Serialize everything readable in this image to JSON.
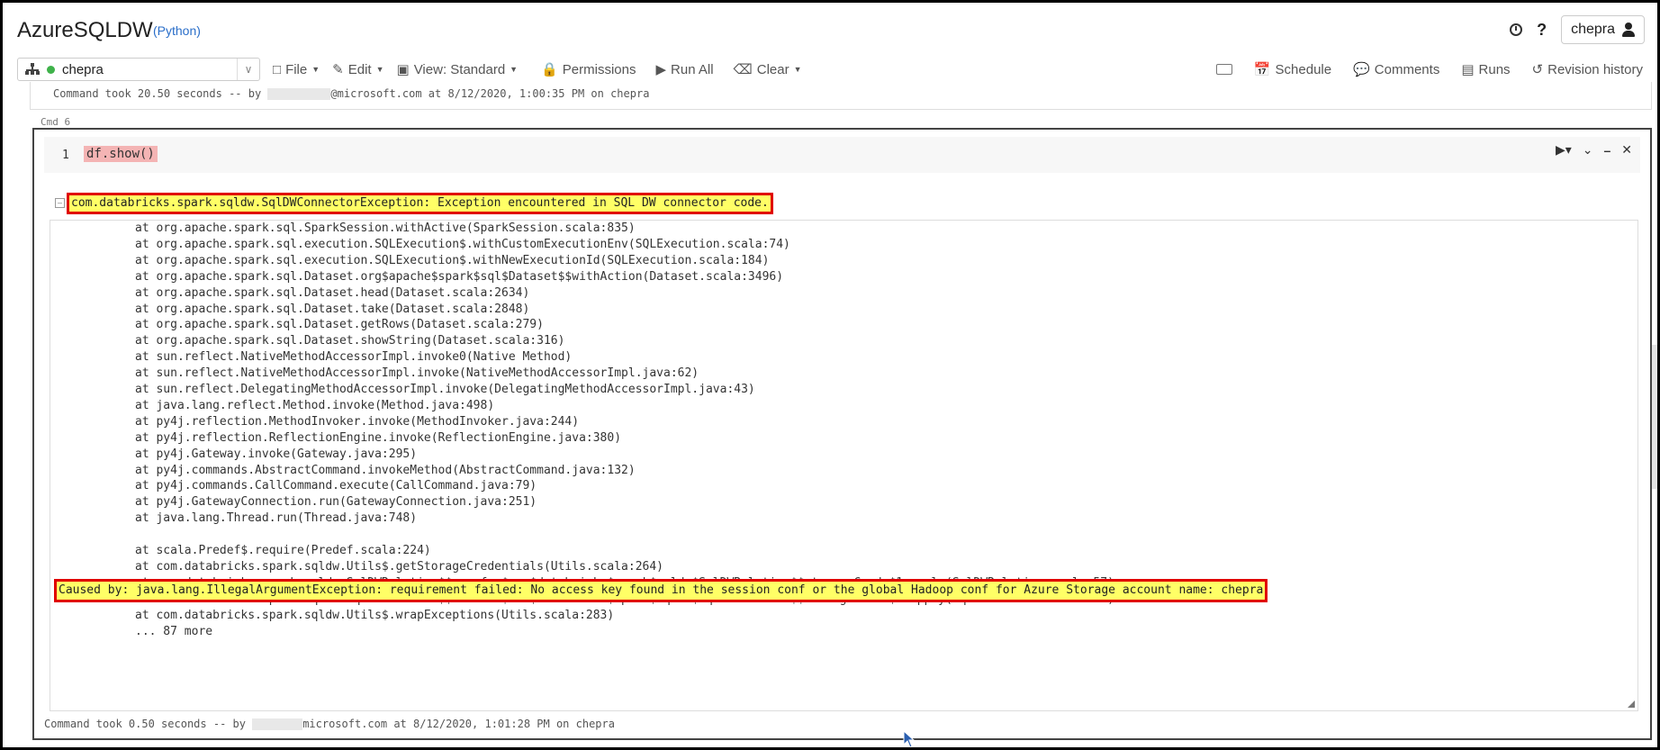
{
  "header": {
    "title": "AzureSQLDW",
    "language": "(Python)",
    "user": "chepra"
  },
  "toolbar": {
    "cluster": "chepra",
    "file": "File",
    "edit": "Edit",
    "view": "View: Standard",
    "permissions": "Permissions",
    "run_all": "Run All",
    "clear": "Clear",
    "schedule": "Schedule",
    "comments": "Comments",
    "runs": "Runs",
    "revision_history": "Revision history"
  },
  "prev_cell": {
    "took_prefix": "Command took 20.50 seconds -- by ",
    "took_suffix": "@microsoft.com at 8/12/2020, 1:00:35 PM on chepra"
  },
  "cell": {
    "label": "Cmd 6",
    "line_number": "1",
    "code": "df.show()",
    "exception": "com.databricks.spark.sqldw.SqlDWConnectorException: Exception encountered in SQL DW connector code.",
    "trace": [
      "at org.apache.spark.sql.SparkSession.withActive(SparkSession.scala:835)",
      "at org.apache.spark.sql.execution.SQLExecution$.withCustomExecutionEnv(SQLExecution.scala:74)",
      "at org.apache.spark.sql.execution.SQLExecution$.withNewExecutionId(SQLExecution.scala:184)",
      "at org.apache.spark.sql.Dataset.org$apache$spark$sql$Dataset$$withAction(Dataset.scala:3496)",
      "at org.apache.spark.sql.Dataset.head(Dataset.scala:2634)",
      "at org.apache.spark.sql.Dataset.take(Dataset.scala:2848)",
      "at org.apache.spark.sql.Dataset.getRows(Dataset.scala:279)",
      "at org.apache.spark.sql.Dataset.showString(Dataset.scala:316)",
      "at sun.reflect.NativeMethodAccessorImpl.invoke0(Native Method)",
      "at sun.reflect.NativeMethodAccessorImpl.invoke(NativeMethodAccessorImpl.java:62)",
      "at sun.reflect.DelegatingMethodAccessorImpl.invoke(DelegatingMethodAccessorImpl.java:43)",
      "at java.lang.reflect.Method.invoke(Method.java:498)",
      "at py4j.reflection.MethodInvoker.invoke(MethodInvoker.java:244)",
      "at py4j.reflection.ReflectionEngine.invoke(ReflectionEngine.java:380)",
      "at py4j.Gateway.invoke(Gateway.java:295)",
      "at py4j.commands.AbstractCommand.invokeMethod(AbstractCommand.java:132)",
      "at py4j.commands.CallCommand.execute(CallCommand.java:79)",
      "at py4j.GatewayConnection.run(GatewayConnection.java:251)",
      "at java.lang.Thread.run(Thread.java:748)"
    ],
    "caused_by": "Caused by: java.lang.IllegalArgumentException: requirement failed: No access key found in the session conf or the global Hadoop conf for Azure Storage account name: chepra",
    "trace2": [
      "at scala.Predef$.require(Predef.scala:224)",
      "at com.databricks.spark.sqldw.Utils$.getStorageCredentials(Utils.scala:264)",
      "at com.databricks.spark.sqldw.SqlDWRelation$$anonfun$com$databricks$spark$sqldw$SqlDWRelation$$storageCreds$1.apply(SqlDWRelation.scala:57)",
      "at com.databricks.spark.sqldw.SqlDWRelation$$anonfun$com$databricks$spark$sqldw$SqlDWRelation$$storageCreds$1.apply(SqlDWRelation.scala:54)",
      "at com.databricks.spark.sqldw.Utils$.wrapExceptions(Utils.scala:283)",
      "... 87 more"
    ],
    "took_prefix": "Command took 0.50 seconds -- by ",
    "took_suffix": "microsoft.com at 8/12/2020, 1:01:28 PM on chepra"
  },
  "colors": {
    "highlight": "#ffff66",
    "highlight_border": "#e00000",
    "status_green": "#3fb24a",
    "code_bg": "#f4b4b4"
  }
}
